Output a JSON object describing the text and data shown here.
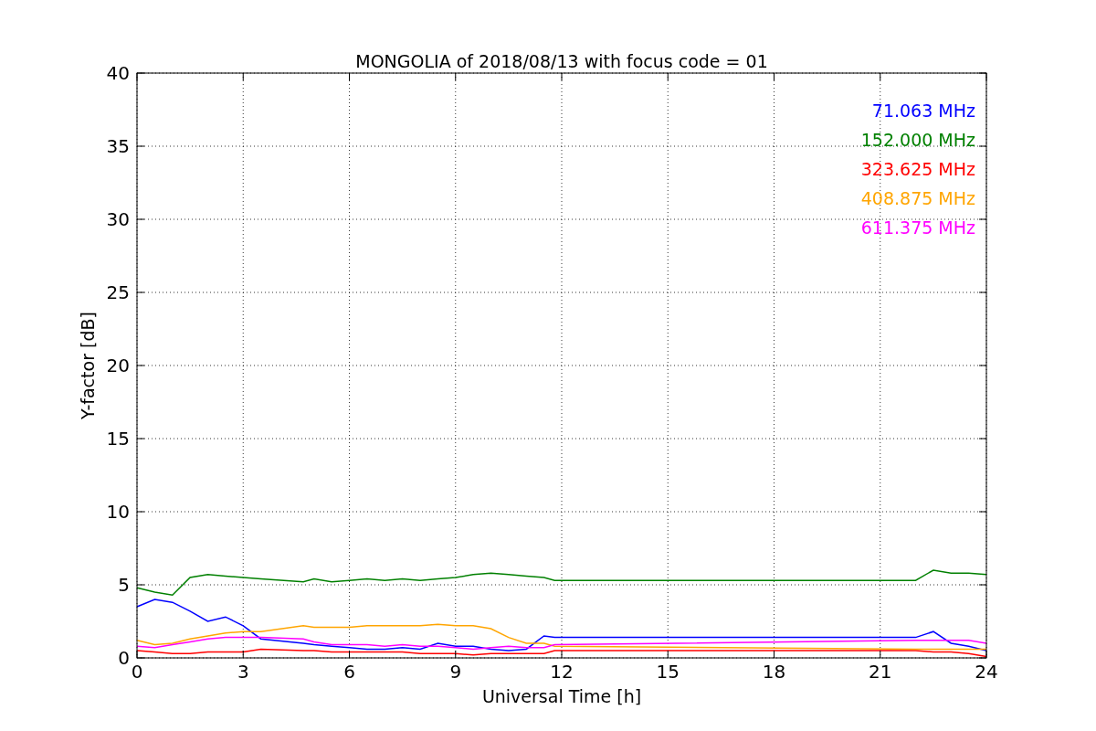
{
  "figure": {
    "chart_data": {
      "type": "line",
      "title": "MONGOLIA of 2018/08/13 with focus code = 01",
      "xlabel": "Universal Time [h]",
      "ylabel": "Y-factor [dB]",
      "x": [
        0,
        0.5,
        1,
        1.5,
        2,
        2.5,
        3,
        3.5,
        4.7,
        5,
        5.5,
        6,
        6.5,
        7,
        7.5,
        8,
        8.5,
        9,
        9.5,
        10,
        10.5,
        11,
        11.5,
        11.8,
        22,
        22.5,
        23,
        23.5,
        24
      ],
      "grid": true,
      "xlim": [
        0,
        24
      ],
      "ylim": [
        0,
        40
      ],
      "xticks": [
        0,
        3,
        6,
        9,
        12,
        15,
        18,
        21,
        24
      ],
      "yticks": [
        0,
        5,
        10,
        15,
        20,
        25,
        30,
        35,
        40
      ],
      "series": [
        {
          "name": "71.063 MHz",
          "color": "#0000ff",
          "values": [
            3.5,
            4,
            3.8,
            3.2,
            2.5,
            2.8,
            2.2,
            1.3,
            1.0,
            0.9,
            0.8,
            0.7,
            0.6,
            0.6,
            0.7,
            0.6,
            1.0,
            0.8,
            0.8,
            0.6,
            0.5,
            0.6,
            1.5,
            1.4,
            1.4,
            1.8,
            1.0,
            0.8,
            0.5
          ]
        },
        {
          "name": "152.000 MHz",
          "color": "#008000",
          "values": [
            4.8,
            4.5,
            4.3,
            5.5,
            5.7,
            5.6,
            5.5,
            5.4,
            5.2,
            5.4,
            5.2,
            5.3,
            5.4,
            5.3,
            5.4,
            5.3,
            5.4,
            5.5,
            5.7,
            5.8,
            5.7,
            5.6,
            5.5,
            5.3,
            5.3,
            6.0,
            5.8,
            5.8,
            5.7
          ]
        },
        {
          "name": "323.625 MHz",
          "color": "#ff0000",
          "values": [
            0.5,
            0.4,
            0.3,
            0.3,
            0.4,
            0.4,
            0.4,
            0.6,
            0.5,
            0.5,
            0.4,
            0.4,
            0.4,
            0.4,
            0.4,
            0.3,
            0.3,
            0.3,
            0.2,
            0.3,
            0.3,
            0.3,
            0.3,
            0.5,
            0.5,
            0.4,
            0.4,
            0.3,
            0.1
          ]
        },
        {
          "name": "408.875 MHz",
          "color": "#ffa500",
          "values": [
            1.2,
            0.9,
            1.0,
            1.3,
            1.5,
            1.7,
            1.8,
            1.8,
            2.2,
            2.1,
            2.1,
            2.1,
            2.2,
            2.2,
            2.2,
            2.2,
            2.3,
            2.2,
            2.2,
            2.0,
            1.4,
            1.0,
            1.0,
            0.8,
            0.6,
            0.6,
            0.6,
            0.6,
            0.6
          ]
        },
        {
          "name": "611.375 MHz",
          "color": "#ff00ff",
          "values": [
            0.8,
            0.7,
            0.9,
            1.1,
            1.3,
            1.4,
            1.4,
            1.4,
            1.3,
            1.1,
            0.9,
            0.9,
            0.9,
            0.8,
            0.9,
            0.8,
            0.8,
            0.7,
            0.6,
            0.7,
            0.8,
            0.7,
            0.7,
            0.9,
            1.2,
            1.2,
            1.2,
            1.2,
            1.0
          ]
        }
      ]
    }
  }
}
